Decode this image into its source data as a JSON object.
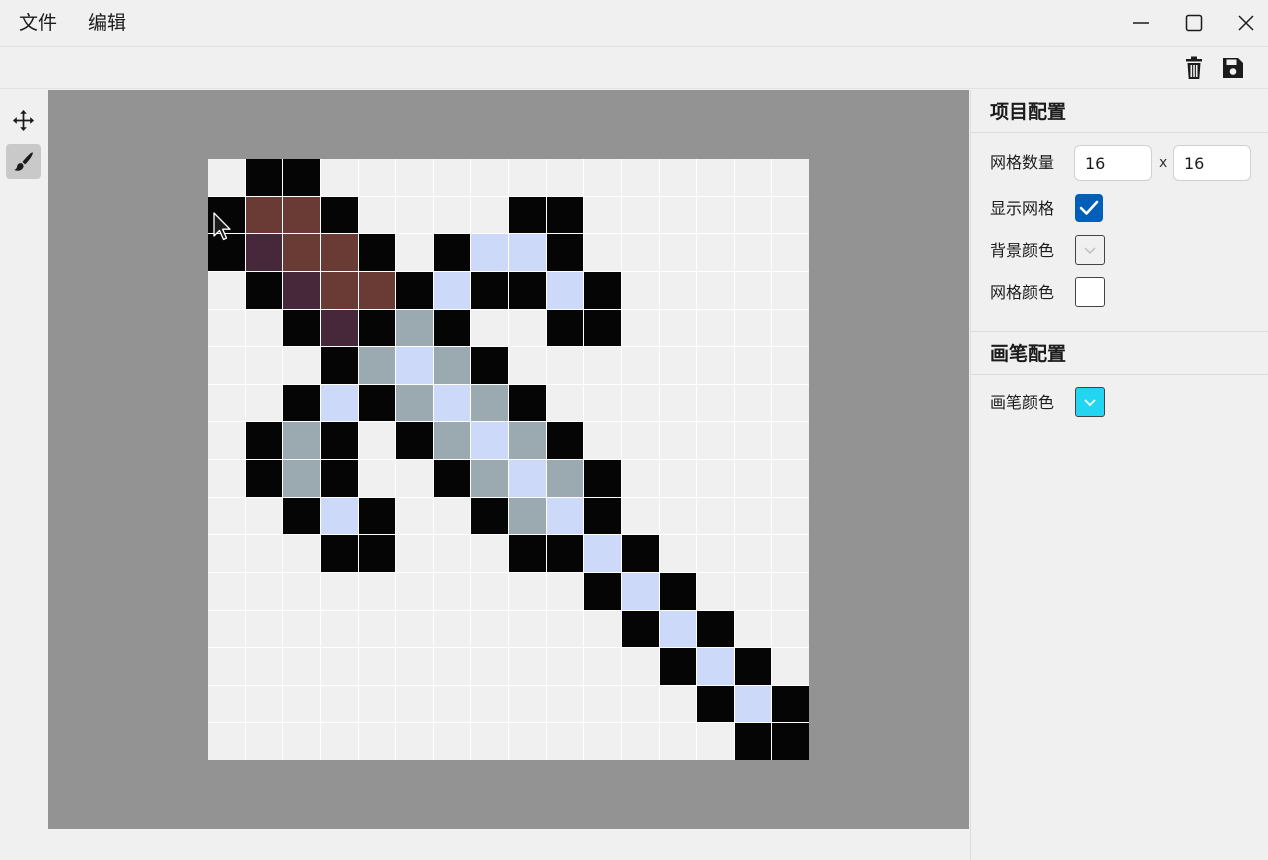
{
  "menu": {
    "file": "文件",
    "edit": "编辑"
  },
  "project": {
    "title": "项目配置",
    "grid_count_label": "网格数量",
    "grid_cols": "16",
    "grid_rows": "16",
    "times_sign": "x",
    "show_grid_label": "显示网格",
    "show_grid": true,
    "bg_color_label": "背景颜色",
    "bg_color": "#f0f0f0",
    "grid_color_label": "网格颜色",
    "grid_color": "#ffffff"
  },
  "brush": {
    "title": "画笔配置",
    "color_label": "画笔颜色",
    "color": "#22d6f2"
  },
  "icons": {
    "minimize": "minimize-icon",
    "maximize": "maximize-icon",
    "close": "close-icon",
    "trash": "trash-icon",
    "save": "save-icon",
    "move": "move-icon",
    "brush": "brush-icon"
  },
  "palette": {
    "B": "#050505",
    "R": "#6a3a34",
    "P": "#46283a",
    "L": "#cdd9f8",
    "G": "#9ba9b1"
  },
  "pixels": [
    ".BB.............",
    "BRRB....BB......",
    "BPRRB.BLLB......",
    ".BPRRBLBBLB.....",
    "..BPBGB..BB.....",
    "...BGLGB........",
    "..BLBGLGB.......",
    ".BGB.BGLGB......",
    ".BGB..BGLGB.....",
    "..BLB..BGLB.....",
    "...BB...BBLB....",
    "..........BLB...",
    "...........BLB..",
    "............BLB.",
    ".............BLB",
    "..............BB"
  ]
}
